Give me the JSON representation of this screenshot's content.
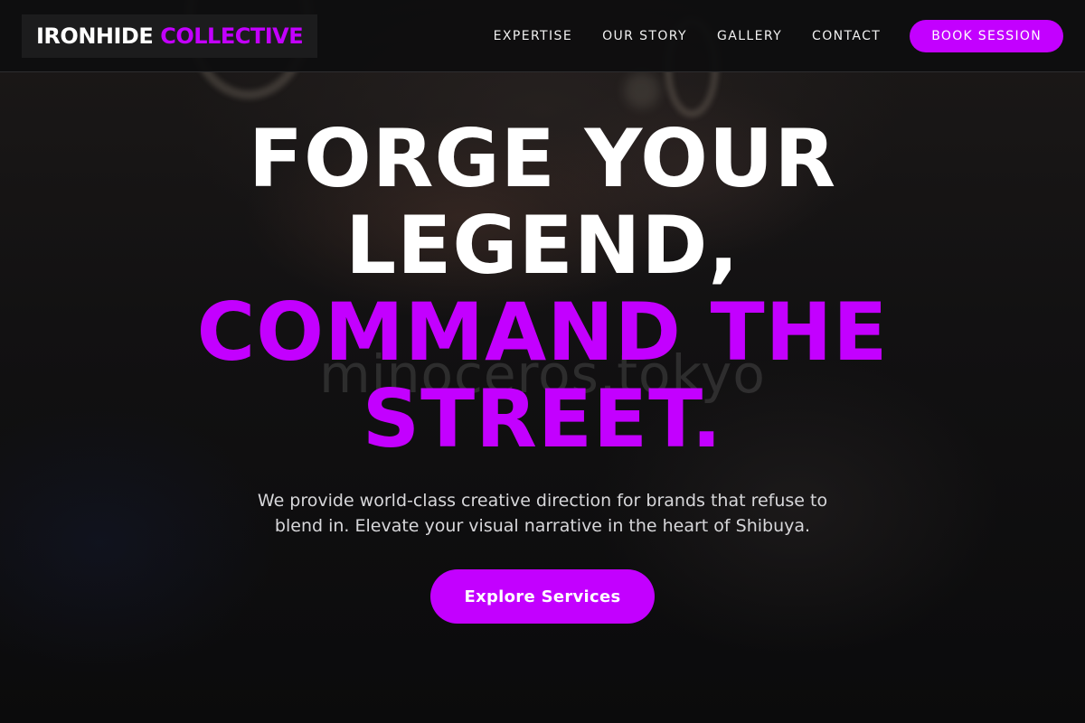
{
  "brand": {
    "name_part1": "IRONHIDE",
    "name_part2": "COLLECTIVE"
  },
  "nav": {
    "links": [
      {
        "label": "EXPERTISE"
      },
      {
        "label": "OUR STORY"
      },
      {
        "label": "GALLERY"
      },
      {
        "label": "CONTACT"
      }
    ],
    "cta_label": "BOOK SESSION"
  },
  "hero": {
    "headline_line1": "FORGE YOUR LEGEND,",
    "headline_line2": "COMMAND THE STREET.",
    "subtitle": "We provide world-class creative direction for brands that refuse to blend in. Elevate your visual narrative in the heart of Shibuya.",
    "cta_label": "Explore Services",
    "background_watermark": "minoceros.tokyo"
  },
  "colors": {
    "accent": "#c300ff",
    "background": "#0b0b0c",
    "text": "#ffffff"
  }
}
